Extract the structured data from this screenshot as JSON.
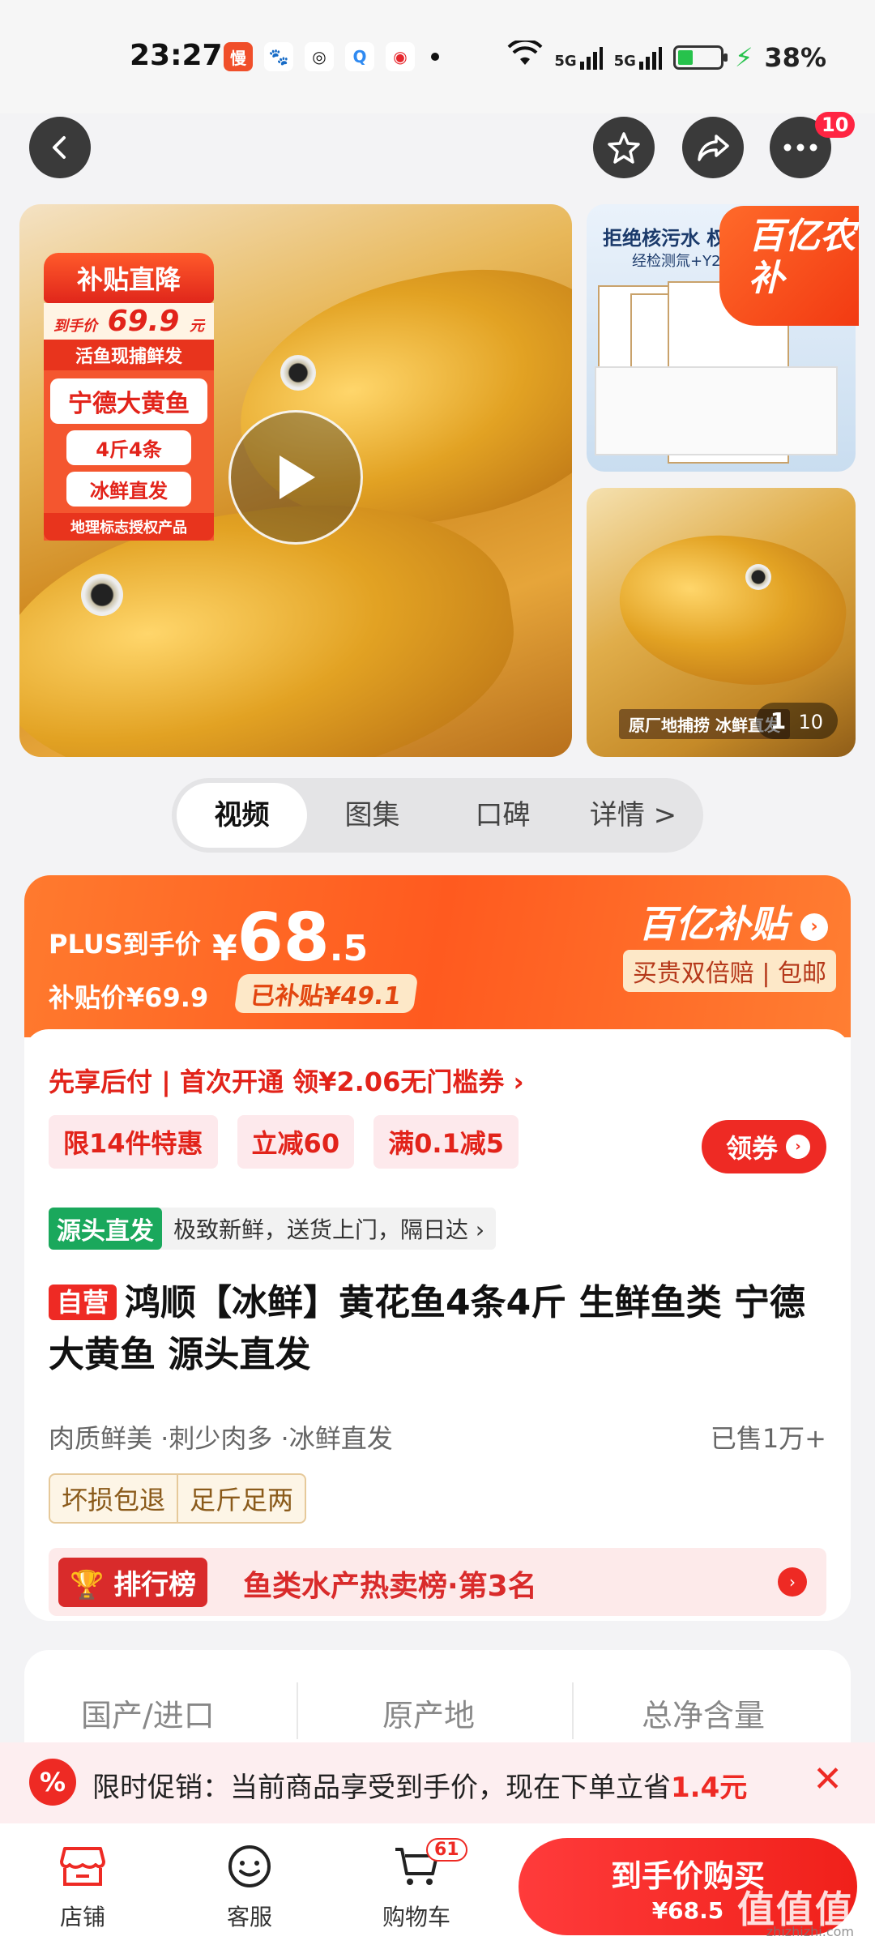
{
  "status_bar": {
    "time": "23:27",
    "apps": [
      "heads-up-app-icon",
      "baidu-icon",
      "wechat-icon",
      "search-app-icon",
      "weibo-icon"
    ],
    "network": "5G",
    "battery": "38%"
  },
  "top_nav": {
    "more_badge": "10"
  },
  "gallery": {
    "promo": {
      "head": "补贴直降",
      "price_prefix": "到手价",
      "price": "69.9",
      "price_unit": "元",
      "line": "活鱼现捕鲜发",
      "name": "宁德大黄鱼",
      "pill1": "4斤4条",
      "pill2": "冰鲜直发",
      "foot": "地理标志授权产品"
    },
    "cert": {
      "title": "拒绝核污水 权威",
      "subtitle": "经检测氚+Y26"
    },
    "yiyi_badge": "百亿农补",
    "side2_label": "原厂地捕捞 冰鲜直发",
    "counter_current": "1",
    "counter_total": "10"
  },
  "tabs": [
    "视频",
    "图集",
    "口碑",
    "详情 >"
  ],
  "price": {
    "plus_label": "PLUS到手价",
    "currency": "¥",
    "integer": "68",
    "decimal": ".5",
    "subsidy_price": "补贴价¥69.9",
    "subsidized": "已补贴¥49.1",
    "brand": "百亿补贴",
    "guarantee": "买贵双倍赔 | 包邮"
  },
  "card": {
    "paylater": "先享后付 | 首次开通 领¥2.06无门槛券 ›",
    "coupons": [
      "限14件特惠",
      "立减60",
      "满0.1减5"
    ],
    "claim_label": "领券",
    "source_tag": "源头直发",
    "source_text": "极致新鲜，送货上门，隔日达 ›",
    "self_operated": "自营",
    "title": "鸿顺【冰鲜】黄花鱼4条4斤 生鲜鱼类 宁德大黄鱼 源头直发",
    "features": "肉质鲜美 ·刺少肉多 ·冰鲜直发",
    "sold": "已售1万+",
    "service_tags": [
      "坏损包退",
      "足斤足两"
    ],
    "rank_label": "排行榜",
    "rank_text": "鱼类水产热卖榜·第3名"
  },
  "specs": [
    "国产/进口",
    "原产地",
    "总净含量"
  ],
  "promo_strip": {
    "icon": "%",
    "text": "限时促销：当前商品享受到手价，现在下单立省",
    "amount": "1.4元",
    "close": "✕"
  },
  "bottom_bar": {
    "store": "店铺",
    "service": "客服",
    "cart": "购物车",
    "cart_count": "61",
    "buy_label": "到手价购买",
    "buy_price": "¥68.5"
  },
  "watermark": {
    "text": "值值值",
    "url": "zhizhizhi.com"
  },
  "colors": {
    "accent": "#ee2a24",
    "orange": "#ff5a1f",
    "green": "#1aa85c"
  }
}
